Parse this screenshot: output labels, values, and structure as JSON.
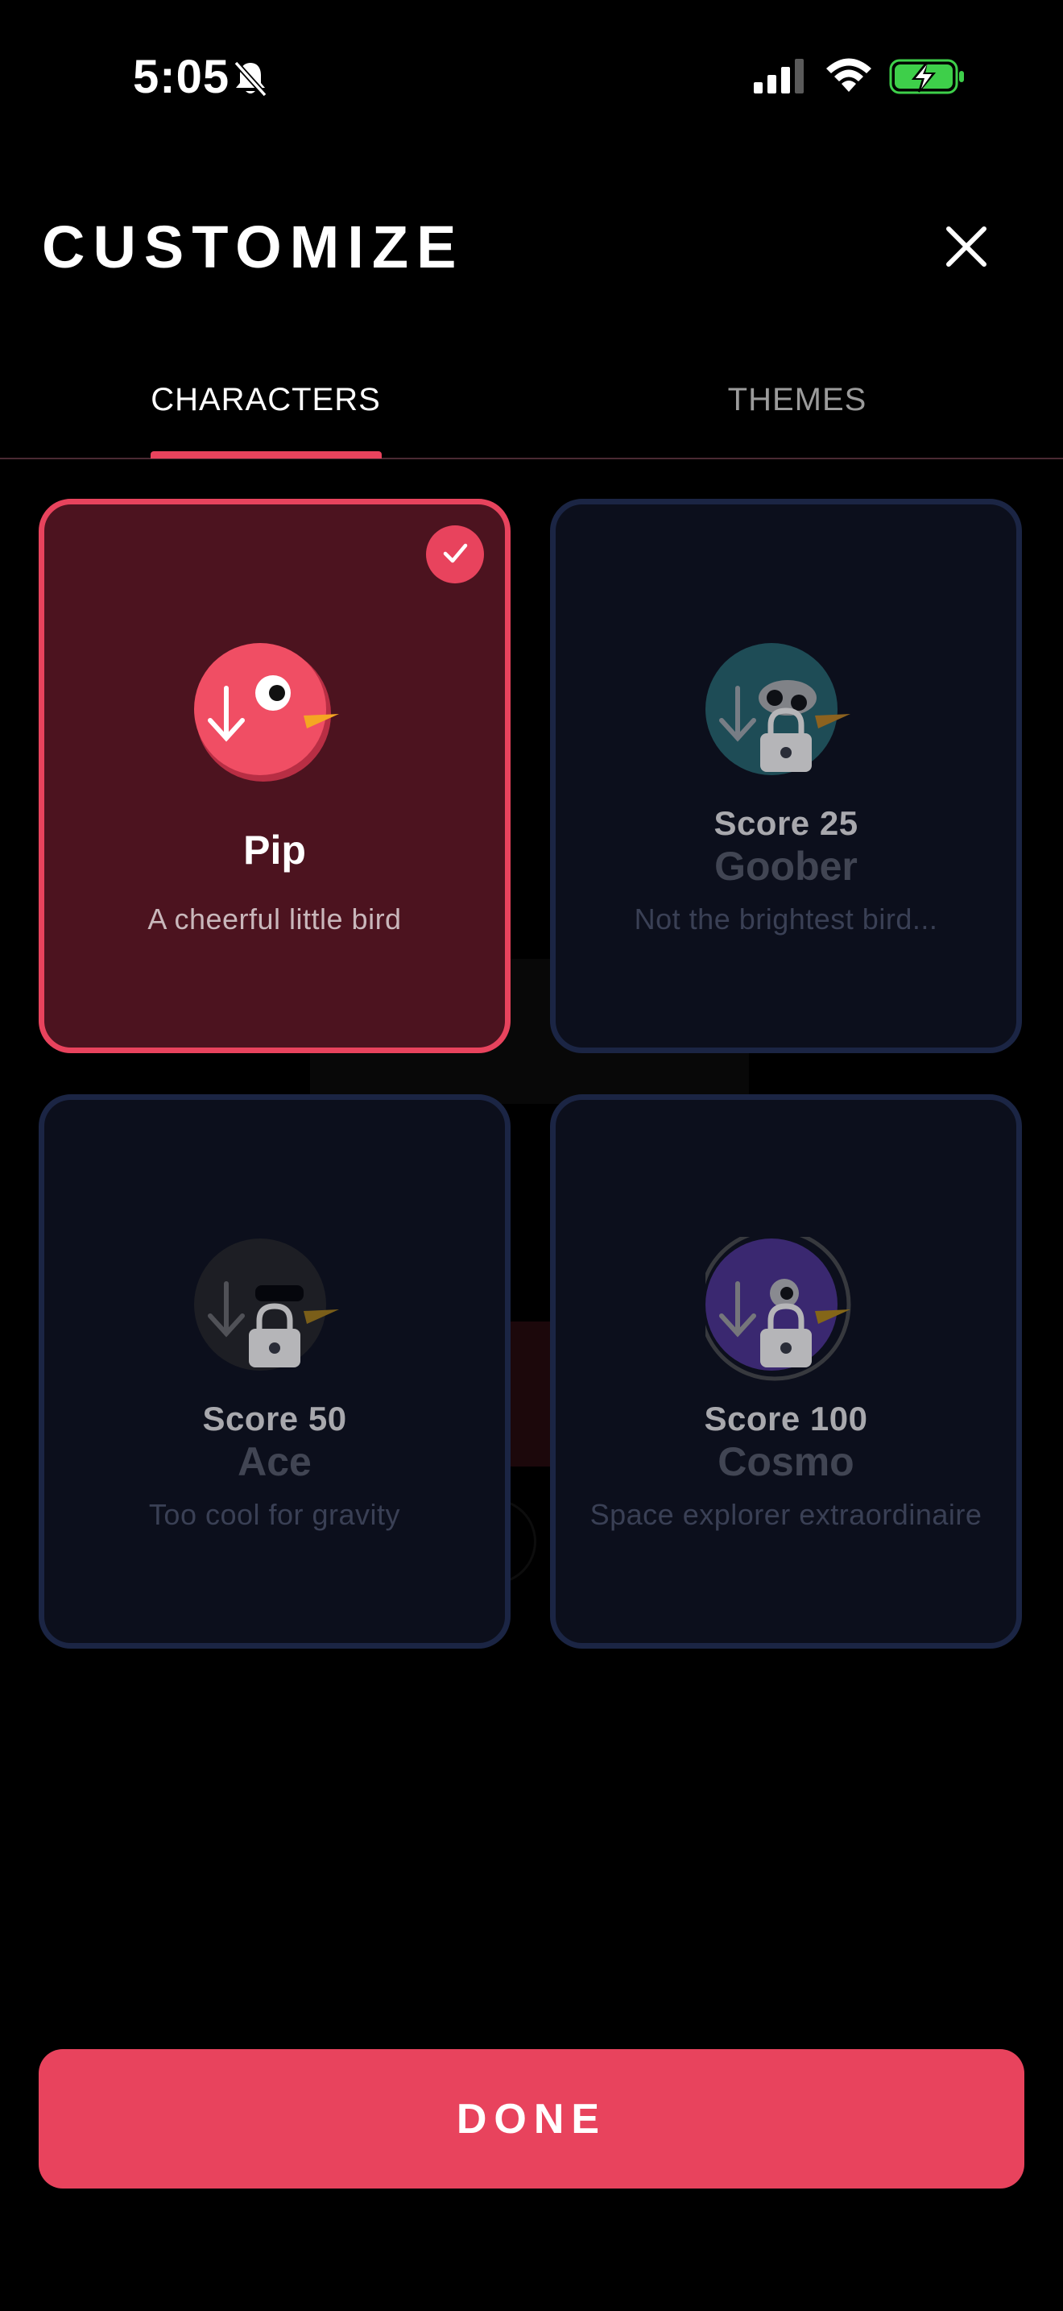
{
  "status_bar": {
    "time": "5:05",
    "icons": [
      "bell-slash-icon",
      "cellular-signal-icon",
      "wifi-icon",
      "battery-charging-icon"
    ]
  },
  "header": {
    "title": "CUSTOMIZE",
    "close_icon": "close-icon"
  },
  "tabs": [
    {
      "label": "CHARACTERS",
      "active": true
    },
    {
      "label": "THEMES",
      "active": false
    }
  ],
  "characters": [
    {
      "name": "Pip",
      "description": "A cheerful little bird",
      "selected": true,
      "locked": false,
      "color": "#e8435d"
    },
    {
      "name": "Goober",
      "description": "Not the brightest bird...",
      "selected": false,
      "locked": true,
      "unlock": "Score 25",
      "color": "#2d7f86"
    },
    {
      "name": "Ace",
      "description": "Too cool for gravity",
      "selected": false,
      "locked": true,
      "unlock": "Score 50",
      "color": "#2a2a2a"
    },
    {
      "name": "Cosmo",
      "description": "Space explorer extraordinaire",
      "selected": false,
      "locked": true,
      "unlock": "Score 100",
      "color": "#5a3aa8"
    }
  ],
  "footer": {
    "done_label": "DONE"
  },
  "colors": {
    "accent": "#e8435d",
    "background": "#000000",
    "selected_card_bg": "#4c131f",
    "locked_card_border": "#1b2544"
  }
}
